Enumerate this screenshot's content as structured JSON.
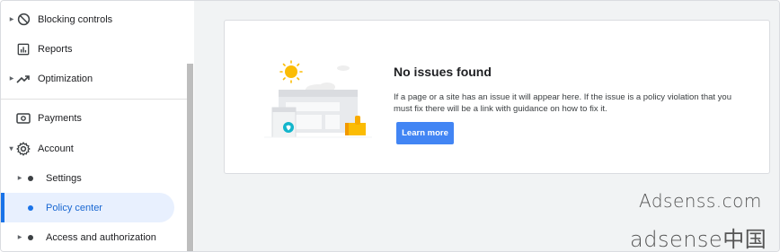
{
  "sidebar": {
    "items": [
      {
        "label": "Blocking controls",
        "icon": "block-icon"
      },
      {
        "label": "Reports",
        "icon": "reports-icon"
      },
      {
        "label": "Optimization",
        "icon": "trending-up-icon"
      },
      {
        "label": "Payments",
        "icon": "payments-icon"
      },
      {
        "label": "Account",
        "icon": "gear-icon"
      }
    ],
    "sub_items": [
      {
        "label": "Settings"
      },
      {
        "label": "Policy center"
      },
      {
        "label": "Access and authorization"
      }
    ]
  },
  "main": {
    "card": {
      "title": "No issues found",
      "description": "If a page or a site has an issue it will appear here. If the issue is a policy violation that you must fix there will be a link with guidance on how to fix it.",
      "button_label": "Learn more"
    }
  },
  "watermark": {
    "line1": "Adsenss.com",
    "line2": "adsense中国"
  },
  "colors": {
    "accent": "#1a73e8",
    "button": "#4285f4",
    "active_bg": "#e8f0fe",
    "sun": "#fbbc04"
  }
}
